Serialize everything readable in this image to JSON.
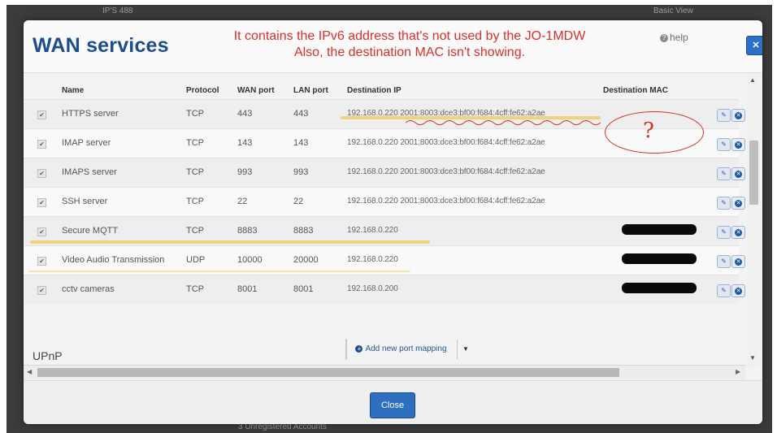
{
  "backdrop": {
    "top_left_label": "IP'S 488",
    "top_right_label": "Basic View",
    "bottom_label": "3 Unregistered Accounts"
  },
  "modal": {
    "title": "WAN services",
    "annotation_line1": "It contains the IPv6 address that's not used by the JO-1MDW",
    "annotation_line2": "Also, the destination MAC isn't showing.",
    "help_label": "help",
    "close_icon": "close-icon",
    "annotation_mark": "?"
  },
  "table": {
    "columns": {
      "name": "Name",
      "protocol": "Protocol",
      "wan_port": "WAN port",
      "lan_port": "LAN port",
      "destination_ip": "Destination IP",
      "destination_mac": "Destination MAC"
    },
    "rows": [
      {
        "checked": true,
        "name": "HTTPS server",
        "protocol": "TCP",
        "wan_port": "443",
        "lan_port": "443",
        "destination_ip": "192.168.0.220 2001:8003:dce3:bf00:f684:4cff:fe62:a2ae",
        "mac_redacted": false
      },
      {
        "checked": true,
        "name": "IMAP server",
        "protocol": "TCP",
        "wan_port": "143",
        "lan_port": "143",
        "destination_ip": "192.168.0.220 2001:8003:dce3:bf00:f684:4cff:fe62:a2ae",
        "mac_redacted": false
      },
      {
        "checked": true,
        "name": "IMAPS server",
        "protocol": "TCP",
        "wan_port": "993",
        "lan_port": "993",
        "destination_ip": "192.168.0.220 2001:8003:dce3:bf00:f684:4cff:fe62:a2ae",
        "mac_redacted": false
      },
      {
        "checked": true,
        "name": "SSH server",
        "protocol": "TCP",
        "wan_port": "22",
        "lan_port": "22",
        "destination_ip": "192.168.0.220 2001:8003:dce3:bf00:f684:4cff:fe62:a2ae",
        "mac_redacted": false
      },
      {
        "checked": true,
        "name": "Secure MQTT",
        "protocol": "TCP",
        "wan_port": "8883",
        "lan_port": "8883",
        "destination_ip": "192.168.0.220",
        "mac_redacted": true
      },
      {
        "checked": true,
        "name": "Video Audio Transmission",
        "protocol": "UDP",
        "wan_port": "10000",
        "lan_port": "20000",
        "destination_ip": "192.168.0.220",
        "mac_redacted": true
      },
      {
        "checked": true,
        "name": "cctv cameras",
        "protocol": "TCP",
        "wan_port": "8001",
        "lan_port": "8001",
        "destination_ip": "192.168.0.200",
        "mac_redacted": true
      }
    ]
  },
  "actions": {
    "add_mapping_label": "Add new port mapping",
    "section_label": "UPnP",
    "close_label": "Close"
  },
  "colors": {
    "title_blue": "#1e4d8c",
    "annotation_red": "#d9302c",
    "primary_button": "#2f6fc0",
    "highlight_yellow": "#f0c84a"
  }
}
